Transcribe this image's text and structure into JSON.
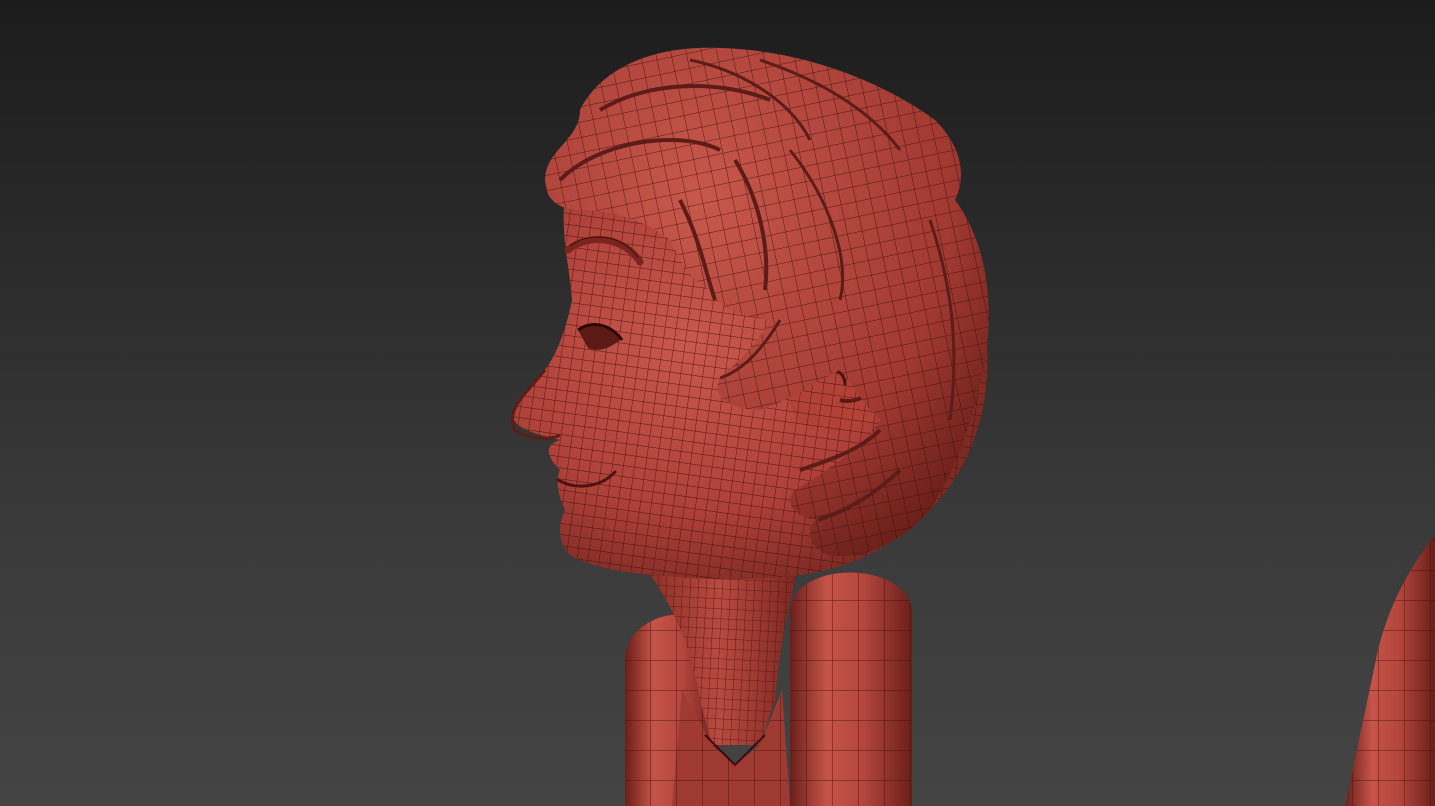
{
  "viewport": {
    "background_top": "#1c1c1c",
    "background_bottom": "#444444"
  },
  "model": {
    "material_color": "#b5443b",
    "shadow_color": "#5e1c18",
    "highlight_color": "#d0665c",
    "wire_color": "#3a0c08",
    "parts": [
      "head",
      "hair",
      "ear",
      "neck",
      "collar",
      "left-shoulder",
      "right-shoulder",
      "arm-far-right"
    ]
  }
}
